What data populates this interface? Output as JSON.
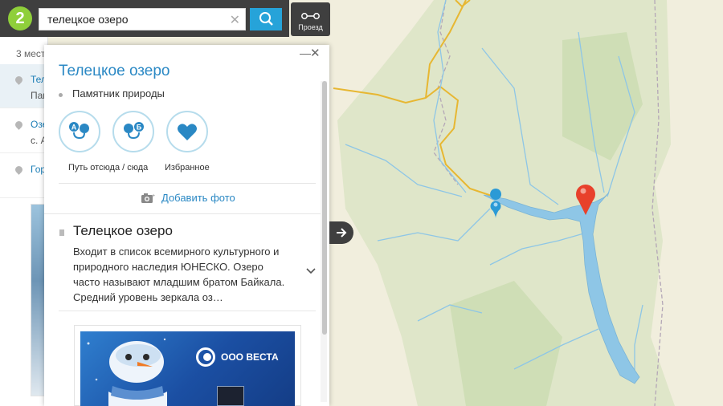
{
  "brand": {
    "color": "#26a3d9",
    "logo_icon": "2gis-logo-icon"
  },
  "search": {
    "query": "телецкое озеро",
    "clear_icon": "close-icon",
    "button_icon": "search-icon"
  },
  "route": {
    "label": "Проезд",
    "icon": "route-icon"
  },
  "results": {
    "count": "3 мест",
    "items": [
      {
        "line1": "Теле",
        "line2": "Пам"
      },
      {
        "line1": "Озе",
        "line2": "с. А"
      },
      {
        "line1": "Гор",
        "line2": ""
      }
    ]
  },
  "card": {
    "title": "Телецкое озеро",
    "category": "Памятник природы",
    "actions": {
      "route_label": "Путь отсюда / сюда",
      "favorite_label": "Избранное"
    },
    "add_photo": "Добавить фото",
    "description": {
      "title": "Телецкое озеро",
      "text": "Входит в список всемирного культурного и природного наследия ЮНЕСКО. Озеро часто называют младшим братом Байкала. Средний уровень зеркала оз…"
    },
    "ad": {
      "brand": "ООО ВЕСТА"
    }
  }
}
